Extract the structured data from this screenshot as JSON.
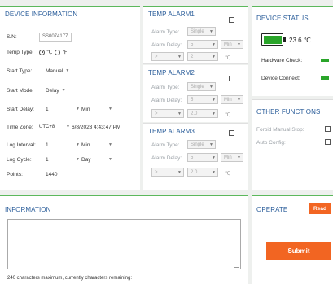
{
  "device_info": {
    "title": "DEVICE INFORMATION",
    "sn_label": "S/N:",
    "sn_value": "SS0074177",
    "temp_type_label": "Temp Type:",
    "unit_c": "℃",
    "unit_f": "℉",
    "start_type_label": "Start Type:",
    "start_type_value": "Manual",
    "start_mode_label": "Start Mode:",
    "start_mode_value": "Delay",
    "start_delay_label": "Start Delay:",
    "start_delay_value": "1",
    "start_delay_unit": "Min",
    "time_zone_label": "Time Zone:",
    "time_zone_value": "UTC+8",
    "time_zone_datetime": "6/8/2023 4:43:47 PM",
    "log_interval_label": "Log Interval:",
    "log_interval_value": "1",
    "log_interval_unit": "Min",
    "log_cycle_label": "Log Cycle:",
    "log_cycle_value": "1",
    "log_cycle_unit": "Day",
    "points_label": "Points:",
    "points_value": "1440"
  },
  "alarms": [
    {
      "title": "TEMP ALARM1",
      "type_label": "Alarm Type:",
      "type_value": "Single",
      "delay_label": "Alarm Delay:",
      "delay_value": "5",
      "delay_unit": "Min",
      "cmp": ">",
      "temp": "2",
      "unit": "℃"
    },
    {
      "title": "TEMP ALARM2",
      "type_label": "Alarm Type:",
      "type_value": "Single",
      "delay_label": "Alarm Delay:",
      "delay_value": "5",
      "delay_unit": "Min",
      "cmp": ">",
      "temp": "2.0",
      "unit": "℃"
    },
    {
      "title": "TEMP ALARM3",
      "type_label": "Alarm Type:",
      "type_value": "Single",
      "delay_label": "Alarm Delay:",
      "delay_value": "5",
      "delay_unit": "Min",
      "cmp": ">",
      "temp": "2.0",
      "unit": "℃"
    }
  ],
  "device_status": {
    "title": "DEVICE STATUS",
    "temperature": "23.6 ℃",
    "hardware_check_label": "Hardware Check:",
    "device_connect_label": "Device Connect:"
  },
  "other_functions": {
    "title": "OTHER FUNCTIONS",
    "forbid_manual_stop_label": "Forbid Manual Stop:",
    "auto_config_label": "Auto Config:"
  },
  "information": {
    "title": "INFORMATION",
    "footer": "240 characters maximum, currently characters remaining:"
  },
  "operate": {
    "title": "OPERATE",
    "read_button": "Read",
    "submit_button": "Submit"
  },
  "colors": {
    "accent_green": "#5cb85c",
    "title_blue": "#2a5d9a",
    "orange": "#f26522",
    "battery_green": "#2aa52a",
    "status_green": "#2aa52a"
  },
  "icons": {
    "battery": "battery-icon",
    "dropdown": "chevron-down-icon"
  }
}
